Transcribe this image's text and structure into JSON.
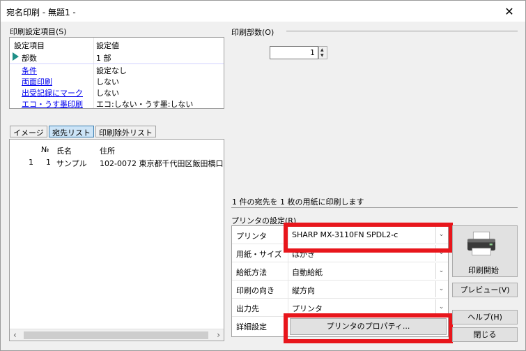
{
  "window": {
    "title": "宛名印刷 - 無題1 -",
    "close_glyph": "✕"
  },
  "settings": {
    "section_label": "印刷設定項目(S)",
    "col_item": "設定項目",
    "col_value": "設定値",
    "rows": [
      {
        "item": "部数",
        "value": "1 部"
      },
      {
        "item": "条件",
        "value": "設定なし"
      },
      {
        "item": "両面印刷",
        "value": "しない"
      },
      {
        "item": "出受記録にマーク",
        "value": "しない"
      },
      {
        "item": "エコ・うす墨印刷",
        "value": "エコ:しない・うす墨:しない"
      }
    ]
  },
  "tabs": [
    {
      "label": "イメージ",
      "active": false
    },
    {
      "label": "宛先リスト",
      "active": true
    },
    {
      "label": "印刷除外リスト",
      "active": false
    }
  ],
  "list": {
    "headers": {
      "num": "№",
      "name": "氏名",
      "address": "住所"
    },
    "rows": [
      {
        "row": "1",
        "num": "1",
        "name": "サンプル",
        "address": "102-0072 東京都千代田区飯田橋口"
      }
    ]
  },
  "copies": {
    "label": "印刷部数(O)",
    "value": "1"
  },
  "message": "1 件の宛先を 1 枚の用紙に印刷します",
  "printer_settings": {
    "section_label": "プリンタの設定(R)",
    "rows": [
      {
        "label": "プリンタ",
        "value": "SHARP MX-3110FN SPDL2-c"
      },
      {
        "label": "用紙・サイズ",
        "value": "はがき"
      },
      {
        "label": "給紙方法",
        "value": "自動給紙"
      },
      {
        "label": "印刷の向き",
        "value": "縦方向"
      },
      {
        "label": "出力先",
        "value": "プリンタ"
      },
      {
        "label": "詳細設定",
        "value": ""
      }
    ],
    "properties_button": "プリンタのプロパティ..."
  },
  "buttons": {
    "print": "印刷開始",
    "preview": "プレビュー(V)",
    "help": "ヘルプ(H)",
    "close": "閉じる"
  },
  "colors": {
    "highlight": "#e8161c",
    "active_tab": "#cce4f7",
    "link": "#0000ee"
  },
  "icons": [
    "close-icon",
    "row-pointer-icon",
    "spin-up-icon",
    "spin-down-icon",
    "chevron-down-icon",
    "scroll-left-icon",
    "scroll-right-icon",
    "printer-icon"
  ]
}
